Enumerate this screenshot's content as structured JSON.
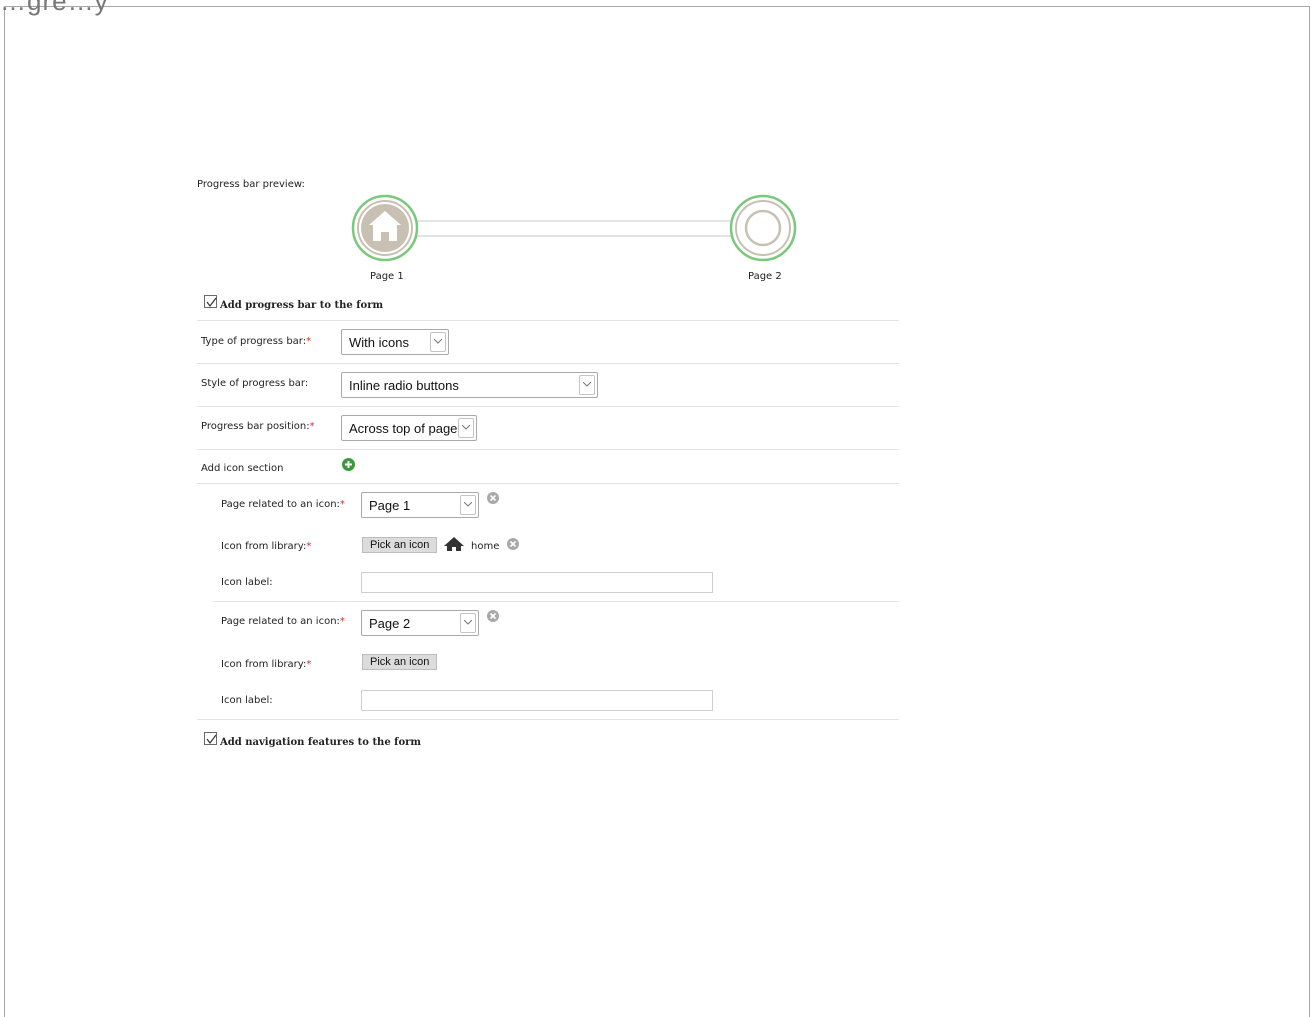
{
  "page": {
    "header_fragment": "…gre…y"
  },
  "preview": {
    "label": "Progress bar preview:",
    "steps": [
      {
        "label": "Page 1",
        "icon": "home-icon",
        "state": "active"
      },
      {
        "label": "Page 2",
        "icon": "circle-icon",
        "state": "active"
      }
    ]
  },
  "add_progress_bar": {
    "label": "Add progress bar to the form",
    "checked": true
  },
  "type": {
    "label": "Type of progress bar:",
    "required_mark": "*",
    "value": "With icons"
  },
  "style": {
    "label": "Style of progress bar:",
    "value": "Inline radio buttons"
  },
  "position": {
    "label": "Progress bar position:",
    "required_mark": "*",
    "value": "Across top of page"
  },
  "add_icon_section": {
    "label": "Add icon section"
  },
  "icon_sections": [
    {
      "page_label": "Page related to an icon:",
      "page_value": "Page 1",
      "library_label": "Icon from library:",
      "pick_label": "Pick an icon",
      "selected_icon_name": "home",
      "icon_label_label": "Icon label:",
      "icon_label_value": ""
    },
    {
      "page_label": "Page related to an icon:",
      "page_value": "Page 2",
      "library_label": "Icon from library:",
      "pick_label": "Pick an icon",
      "icon_label_label": "Icon label:",
      "icon_label_value": ""
    }
  ],
  "required_mark": "*",
  "add_navigation": {
    "label": "Add navigation features to the form",
    "checked": true
  },
  "colors": {
    "accent_green": "#79c97d",
    "required_red": "#e0262a",
    "icon_grey": "#c8c1b3"
  }
}
